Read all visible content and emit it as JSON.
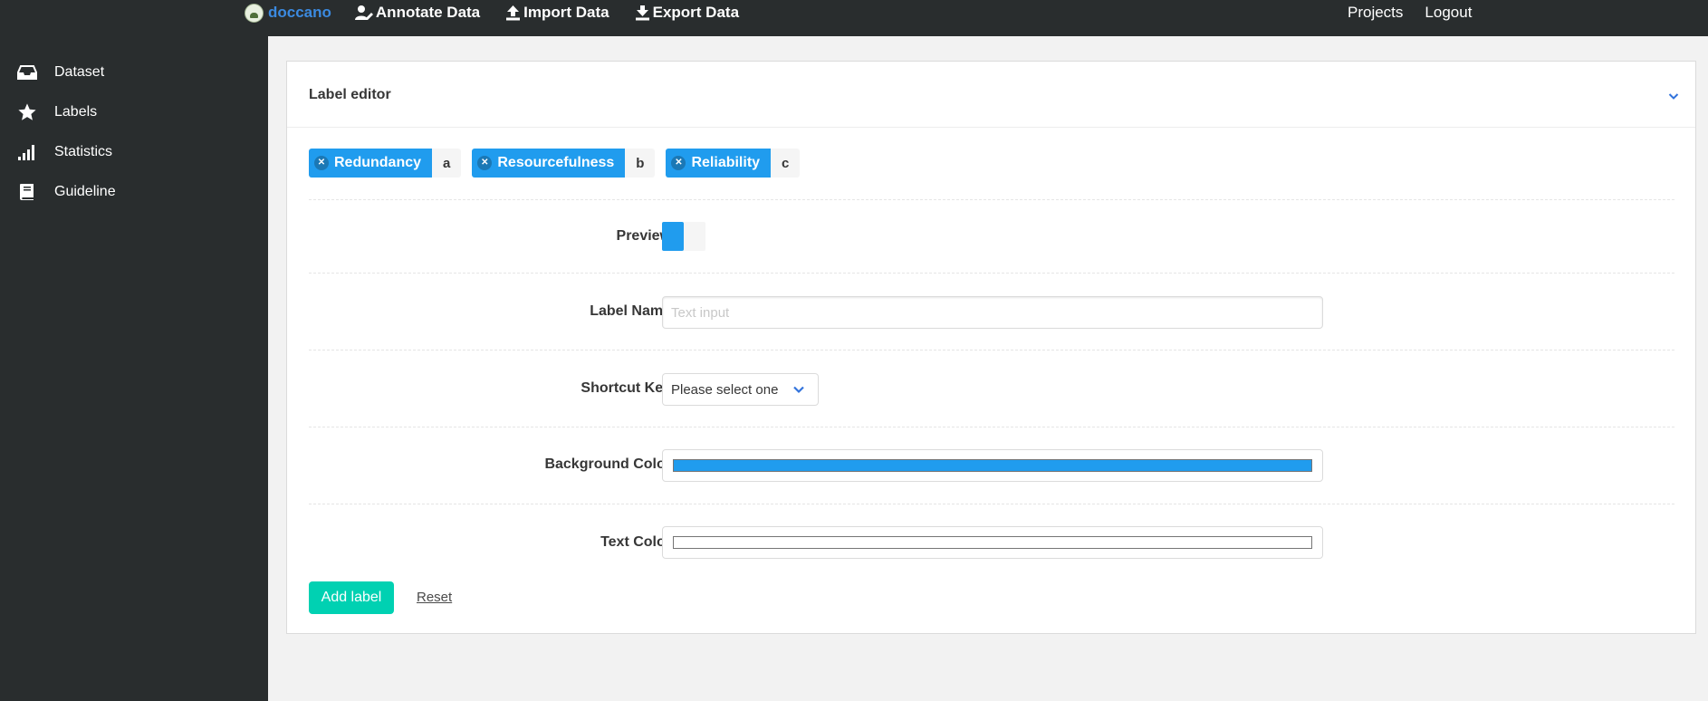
{
  "navbar": {
    "brand": "doccano",
    "items": [
      {
        "label": "Annotate Data",
        "icon": "user-edit-icon"
      },
      {
        "label": "Import Data",
        "icon": "upload-icon"
      },
      {
        "label": "Export Data",
        "icon": "download-icon"
      }
    ],
    "right": [
      "Projects",
      "Logout"
    ]
  },
  "sidebar": {
    "items": [
      {
        "label": "Dataset",
        "icon": "inbox-icon"
      },
      {
        "label": "Labels",
        "icon": "star-icon"
      },
      {
        "label": "Statistics",
        "icon": "signal-icon"
      },
      {
        "label": "Guideline",
        "icon": "book-icon"
      }
    ]
  },
  "card": {
    "title": "Label editor",
    "labels": [
      {
        "name": "Redundancy",
        "key": "a"
      },
      {
        "name": "Resourcefulness",
        "key": "b"
      },
      {
        "name": "Reliability",
        "key": "c"
      }
    ],
    "form": {
      "preview_label": "Preview",
      "label_name_label": "Label Name",
      "label_name_placeholder": "Text input",
      "label_name_value": "",
      "shortcut_label": "Shortcut Key",
      "shortcut_value": "Please select one",
      "background_label": "Background Color",
      "background_value": "#209cee",
      "text_color_label": "Text Color",
      "text_color_value": "#ffffff"
    },
    "add_label": "Add label",
    "reset": "Reset"
  },
  "colors": {
    "navbar": "#292d2e",
    "accent": "#209cee",
    "brand": "#3b8ae0",
    "primary_button": "#00d1b2"
  }
}
